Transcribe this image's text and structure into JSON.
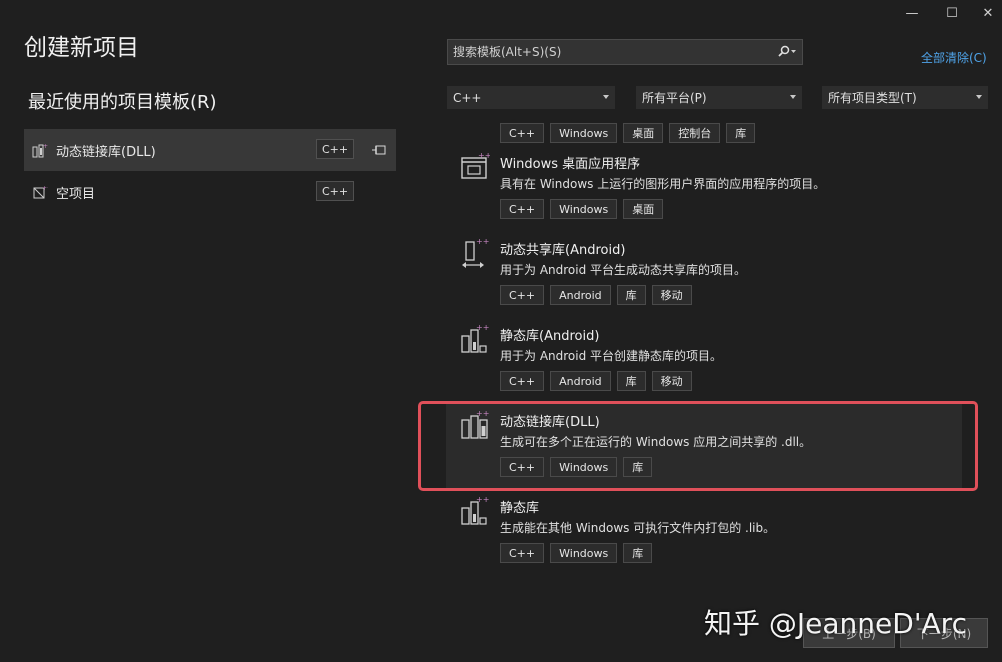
{
  "window_controls": {
    "minimize": "—",
    "maximize": "☐",
    "close": "✕"
  },
  "title": "创建新项目",
  "recent": {
    "heading": "最近使用的项目模板(R)",
    "items": [
      {
        "label": "动态链接库(DLL)",
        "tag": "C++",
        "pinned": true,
        "icon": "dll-project-icon"
      },
      {
        "label": "空项目",
        "tag": "C++",
        "pinned": false,
        "icon": "empty-project-icon"
      }
    ]
  },
  "search": {
    "placeholder": "搜索模板(Alt+S)(S)",
    "value": ""
  },
  "clear_all": "全部清除(C)",
  "filters": {
    "language": "C++",
    "platform": "所有平台(P)",
    "project_type": "所有项目类型(T)"
  },
  "templates": [
    {
      "name": "",
      "desc": "",
      "tags": [
        "C++",
        "Windows",
        "桌面",
        "控制台",
        "库"
      ],
      "icon": "partial-icon"
    },
    {
      "name": "Windows 桌面应用程序",
      "desc": "具有在 Windows 上运行的图形用户界面的应用程序的项目。",
      "tags": [
        "C++",
        "Windows",
        "桌面"
      ],
      "icon": "windows-desktop-app-icon"
    },
    {
      "name": "动态共享库(Android)",
      "desc": "用于为 Android 平台生成动态共享库的项目。",
      "tags": [
        "C++",
        "Android",
        "库",
        "移动"
      ],
      "icon": "android-shared-library-icon"
    },
    {
      "name": "静态库(Android)",
      "desc": "用于为 Android 平台创建静态库的项目。",
      "tags": [
        "C++",
        "Android",
        "库",
        "移动"
      ],
      "icon": "android-static-library-icon"
    },
    {
      "name": "动态链接库(DLL)",
      "desc": "生成可在多个正在运行的 Windows 应用之间共享的 .dll。",
      "tags": [
        "C++",
        "Windows",
        "库"
      ],
      "icon": "dll-icon"
    },
    {
      "name": "静态库",
      "desc": "生成能在其他 Windows 可执行文件内打包的 .lib。",
      "tags": [
        "C++",
        "Windows",
        "库"
      ],
      "icon": "static-library-icon"
    }
  ],
  "footer": {
    "back": "上一步(B)",
    "next": "下一步(N)"
  },
  "watermark": "知乎 @JeanneD'Arc",
  "colors": {
    "accent_link": "#4fa3e8",
    "highlight": "#e0505a",
    "icon_purple": "#c586c0"
  }
}
